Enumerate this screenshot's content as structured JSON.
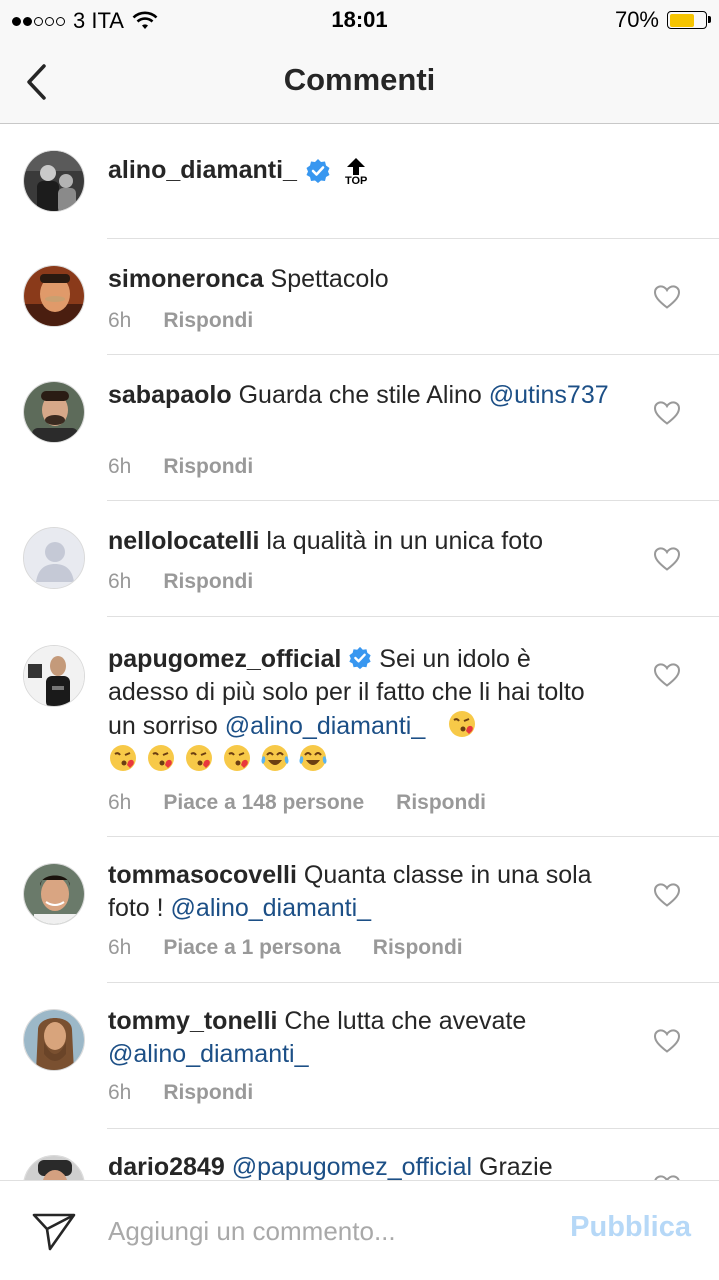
{
  "status_bar": {
    "carrier": "3 ITA",
    "time": "18:01",
    "battery": "70%",
    "battery_level": 0.7,
    "icons": [
      "signal-dots-icon",
      "wifi-icon",
      "battery-icon"
    ]
  },
  "nav": {
    "title": "Commenti",
    "back_icon": "chevron-left-icon"
  },
  "caption": {
    "username": "alino_diamanti_",
    "badge_label": "TOP"
  },
  "comments": [
    {
      "username": "simoneronca",
      "text": " Spettacolo",
      "time": "6h",
      "likes": "",
      "reply": "Rispondi"
    },
    {
      "username": "sabapaolo",
      "text": " Guarda che stile Alino ",
      "mention": "@utins737",
      "time": "6h",
      "likes": "",
      "reply": "Rispondi"
    },
    {
      "username": "nellolocatelli",
      "text": " la qualità in un unica foto",
      "time": "6h",
      "likes": "",
      "reply": "Rispondi"
    },
    {
      "username": "papugomez_official",
      "text": " Sei un idolo è adesso di più solo per il fatto che li hai tolto un sorriso ",
      "mention": "@alino_diamanti_",
      "time": "6h",
      "likes": "Piace a 148 persone",
      "reply": "Rispondi"
    },
    {
      "username": "tommasocovelli",
      "text": " Quanta classe in una sola foto ! ",
      "mention": "@alino_diamanti_",
      "time": "6h",
      "likes": "Piace a 1 persona",
      "reply": "Rispondi"
    },
    {
      "username": "tommy_tonelli",
      "text": " Che lutta che avevate ",
      "mention": "@alino_diamanti_",
      "time": "6h",
      "likes": "",
      "reply": "Rispondi"
    },
    {
      "username": "dario2849",
      "text": " Grazie",
      "mention_first": "@papugomez_official",
      "time": "",
      "likes": "",
      "reply": ""
    }
  ],
  "input": {
    "placeholder": "Aggiungi un commento...",
    "publish_label": "Pubblica",
    "publish_color": "#b6d8f7"
  },
  "colors": {
    "mention": "#1c4f86",
    "verified": "#3897f0",
    "meta": "#999999"
  }
}
